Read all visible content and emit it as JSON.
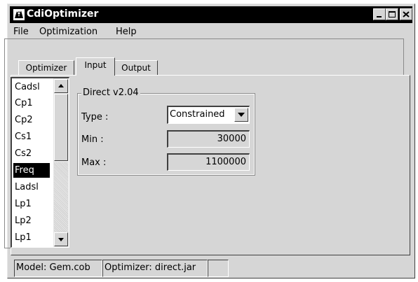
{
  "window": {
    "title": "CdiOptimizer",
    "icon": "app-icon",
    "controls": [
      "minimize-icon",
      "maximize-icon",
      "close-icon"
    ]
  },
  "menu": {
    "items": [
      {
        "label": "File"
      },
      {
        "label": "Optimization"
      },
      {
        "label": "Help"
      }
    ]
  },
  "tabs": [
    {
      "label": "Optimizer",
      "active": false
    },
    {
      "label": "Input",
      "active": true
    },
    {
      "label": "Output",
      "active": false
    }
  ],
  "list": {
    "items": [
      "Cadsl",
      "Cp1",
      "Cp2",
      "Cs1",
      "Cs2",
      "Freq",
      "Ladsl",
      "Lp1",
      "Lp2",
      "Lp1"
    ],
    "selected": "Freq"
  },
  "group": {
    "title": "Direct v2.04",
    "type_label": "Type :",
    "type_value": "Constrained",
    "min_label": "Min :",
    "min_value": "30000",
    "max_label": "Max :",
    "max_value": "1100000"
  },
  "status": {
    "model": "Model: Gem.cob",
    "optimizer": "Optimizer: direct.jar",
    "extra": ""
  }
}
